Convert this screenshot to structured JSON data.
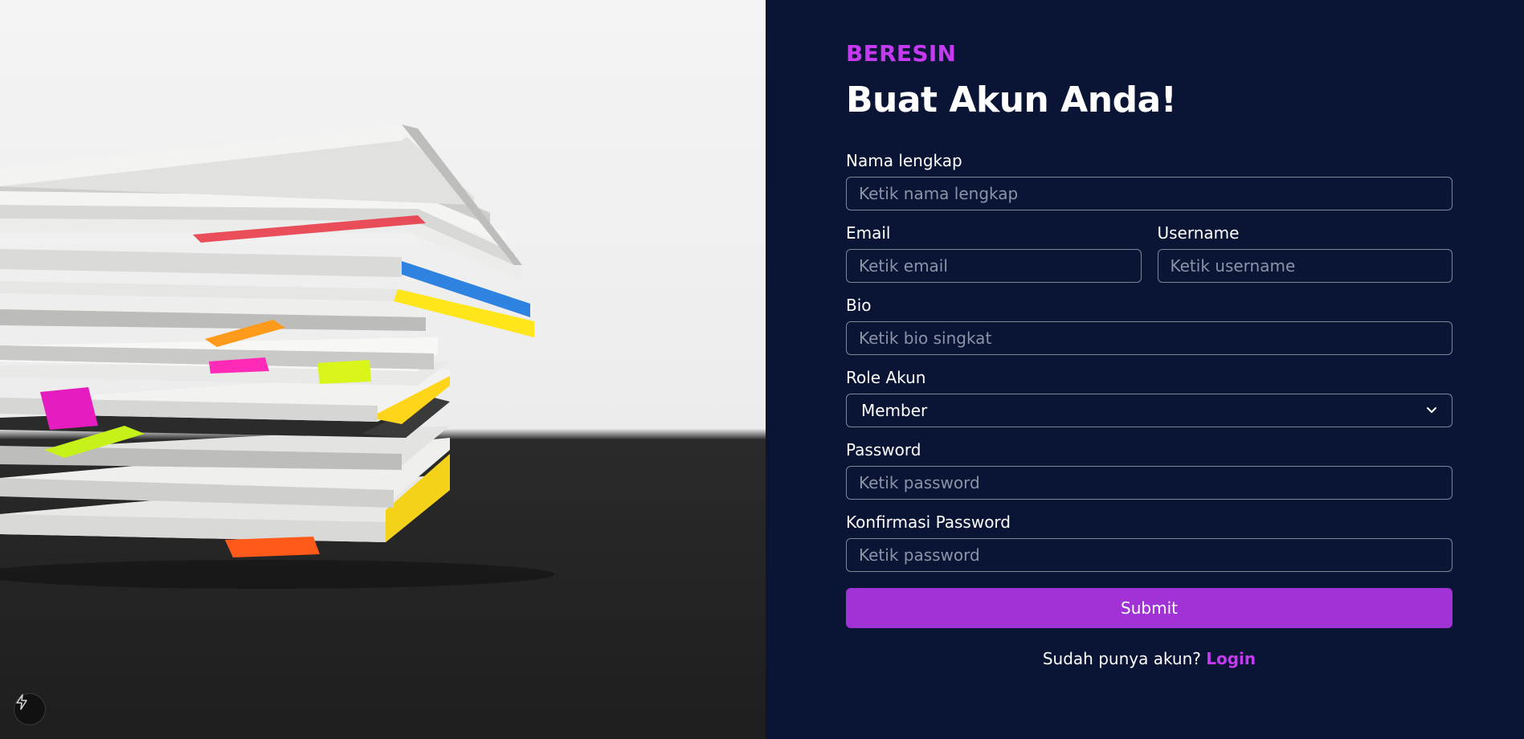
{
  "brand": "BERESIN",
  "title": "Buat Akun Anda!",
  "fields": {
    "fullname": {
      "label": "Nama lengkap",
      "placeholder": "Ketik nama lengkap"
    },
    "email": {
      "label": "Email",
      "placeholder": "Ketik email"
    },
    "username": {
      "label": "Username",
      "placeholder": "Ketik username"
    },
    "bio": {
      "label": "Bio",
      "placeholder": "Ketik bio singkat"
    },
    "role": {
      "label": "Role Akun",
      "value": "Member"
    },
    "password": {
      "label": "Password",
      "placeholder": "Ketik password"
    },
    "confirm": {
      "label": "Konfirmasi Password",
      "placeholder": "Ketik password"
    }
  },
  "submit_label": "Submit",
  "footer": {
    "text": "Sudah punya akun?",
    "link": "Login"
  },
  "colors": {
    "background": "#0a1535",
    "accent": "#c53af0",
    "button": "#a032d6"
  },
  "icons": {
    "fab": "lightning-icon",
    "select": "chevron-down-icon"
  }
}
